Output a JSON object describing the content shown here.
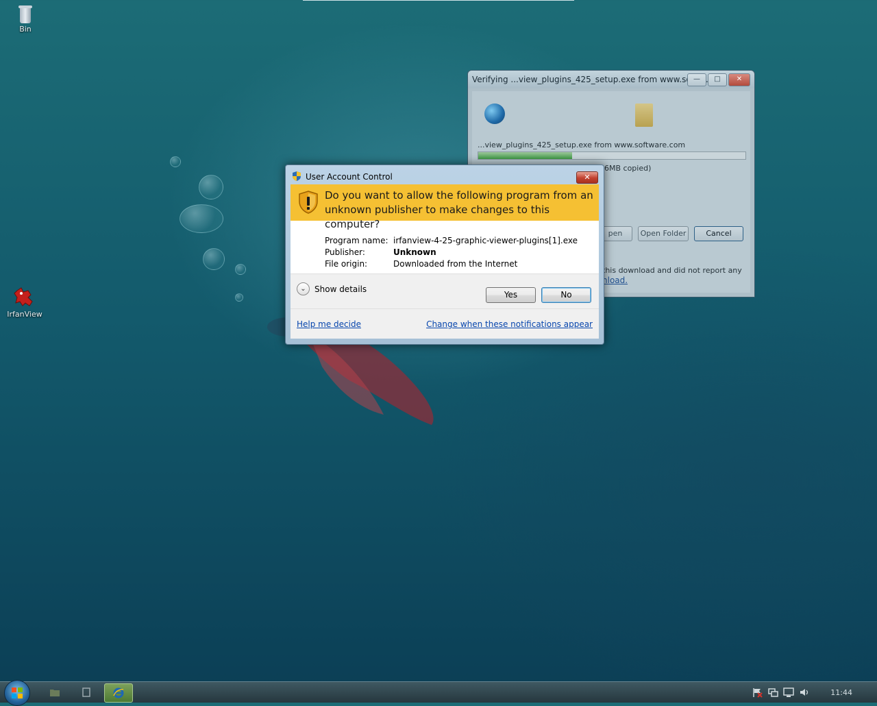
{
  "desktop": {
    "icons": [
      {
        "label": "Bin",
        "icon": "recycle-bin-icon"
      },
      {
        "label": "IrfanView",
        "icon": "irfanview-icon"
      }
    ]
  },
  "download_window": {
    "title": "Verifying ...view_plugins_425_setup.exe from www.softw...",
    "file_line": "...view_plugins_425_setup.exe from www.software.com",
    "copied_text": "66MB copied)",
    "progress_fraction": 0.35,
    "buttons": {
      "open": "pen",
      "open_folder": "Open Folder",
      "cancel": "Cancel"
    },
    "note_line1": "this download and did not report any",
    "note_link": "nload."
  },
  "uac": {
    "title": "User Account Control",
    "question": "Do you want to allow the following program from an unknown publisher to make changes to this computer?",
    "fields": [
      {
        "label": "Program name:",
        "value": "irfanview-4-25-graphic-viewer-plugins[1].exe",
        "bold": false
      },
      {
        "label": "Publisher:",
        "value": "Unknown",
        "bold": true
      },
      {
        "label": "File origin:",
        "value": "Downloaded from the Internet",
        "bold": false
      }
    ],
    "show_details": "Show details",
    "yes_label": "Yes",
    "no_label": "No",
    "help_link": "Help me decide",
    "change_link": "Change when these notifications appear",
    "banner_color": "#f5c033"
  },
  "taskbar": {
    "clock": "11:44",
    "pinned": [
      "folder-icon",
      "window-icon",
      "internet-explorer-icon"
    ],
    "tray": [
      "action-center-flag-icon",
      "network-icon",
      "display-icon",
      "volume-icon"
    ]
  }
}
